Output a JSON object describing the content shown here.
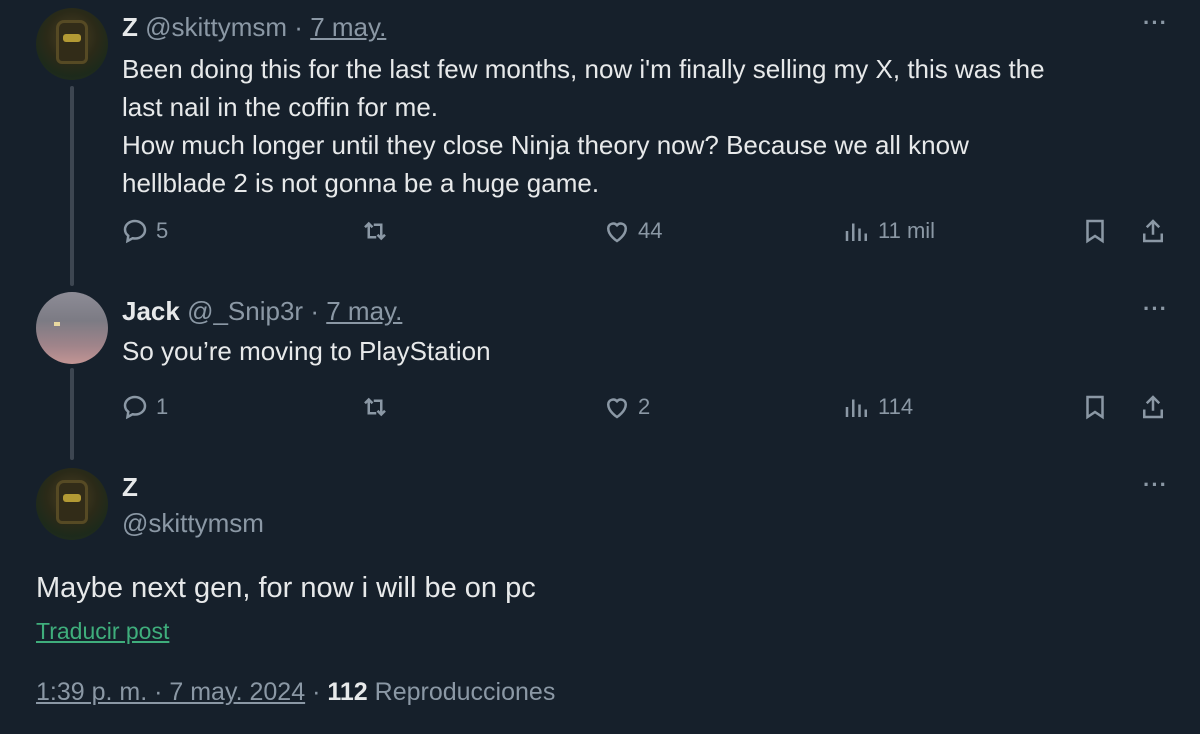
{
  "posts": [
    {
      "name": "Z",
      "handle": "@skittymsm",
      "separator": "·",
      "date": "7 may.",
      "more": "···",
      "text_lines": [
        "Been doing this for the last few months, now i'm finally selling my X, this was the",
        "last nail in the coffin for me.",
        "How much longer until they close Ninja theory now? Because we all know",
        "hellblade 2 is not gonna be a huge game."
      ],
      "replies": "5",
      "reposts": "",
      "likes": "44",
      "views": "11 mil"
    },
    {
      "name": "Jack",
      "handle": "@_Snip3r",
      "separator": "·",
      "date": "7 may.",
      "more": "···",
      "text_lines": [
        "So you’re moving to PlayStation"
      ],
      "replies": "1",
      "reposts": "",
      "likes": "2",
      "views": "114"
    }
  ],
  "focus": {
    "name": "Z",
    "handle": "@skittymsm",
    "more": "···",
    "text": "Maybe next gen, for now i will be on pc",
    "translate": "Traducir post",
    "time": "1:39 p. m. · 7 may. 2024",
    "separator": "·",
    "views_count": "112",
    "views_label": "Reproducciones"
  },
  "icons": [
    "reply-icon",
    "repost-icon",
    "like-icon",
    "views-icon",
    "bookmark-icon",
    "share-icon"
  ],
  "colors": {
    "background": "#16202b",
    "text": "#e7e9ea",
    "muted": "#8b98a5",
    "link": "#3fae7c"
  }
}
